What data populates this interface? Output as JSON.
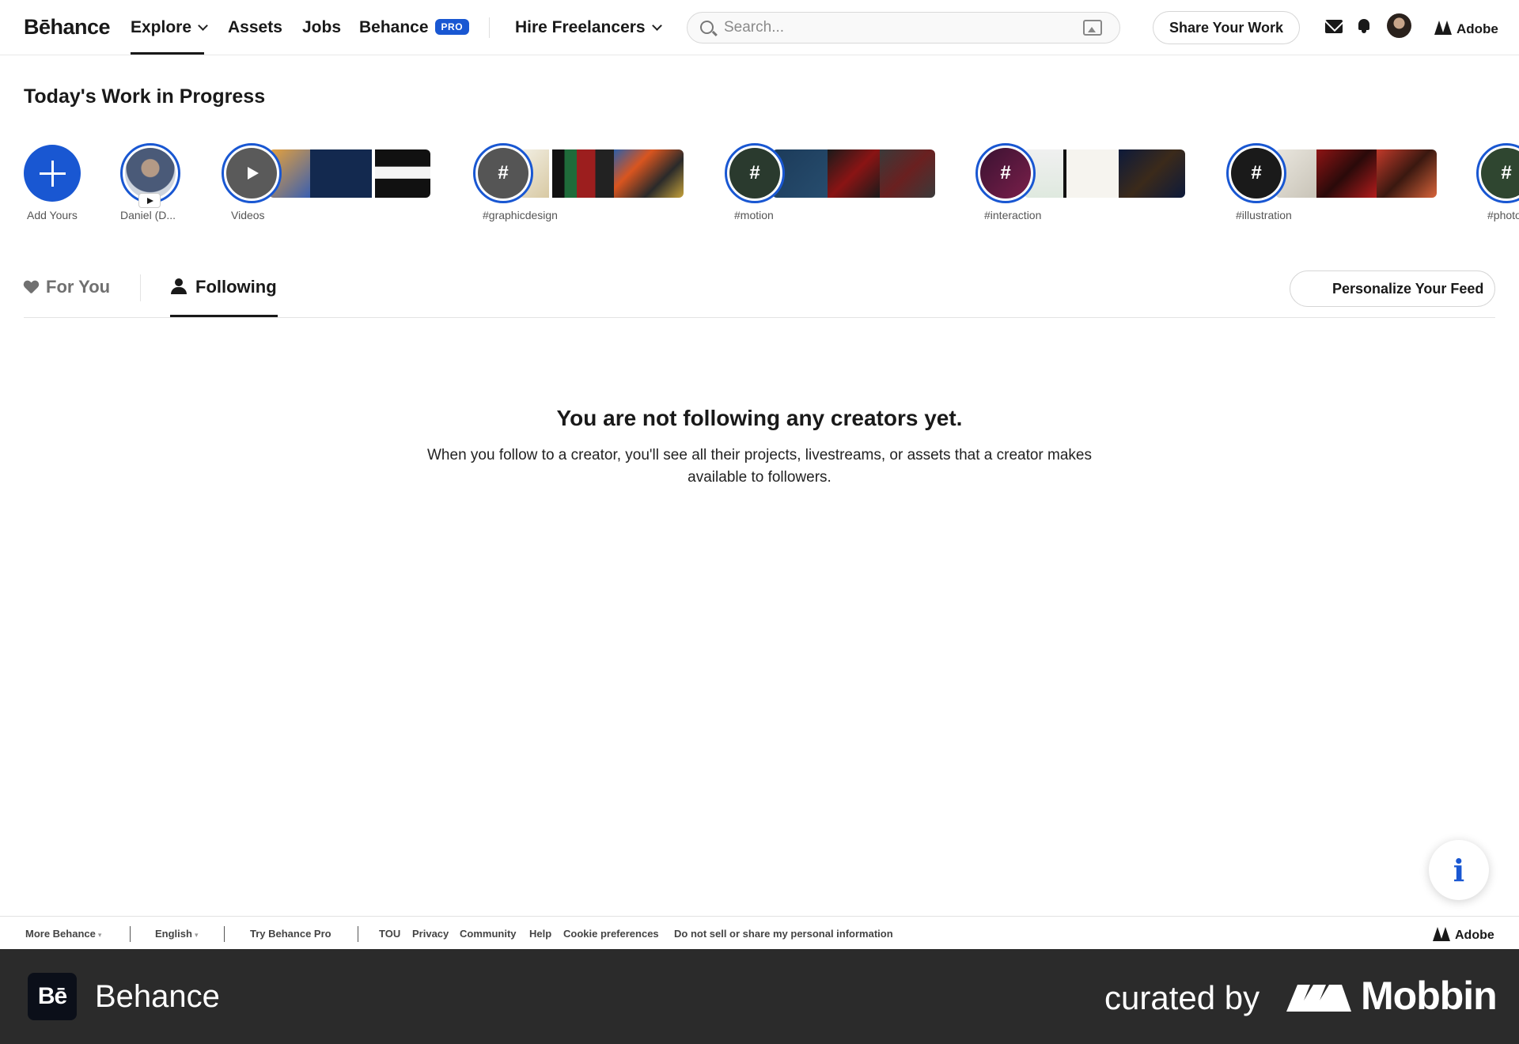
{
  "nav": {
    "logo": "Bēhance",
    "explore": "Explore",
    "assets": "Assets",
    "jobs": "Jobs",
    "behance": "Behance",
    "pro_badge": "PRO",
    "hire": "Hire Freelancers",
    "search_placeholder": "Search...",
    "share": "Share Your Work",
    "adobe": "Adobe",
    "accent_color": "#1957d2"
  },
  "wip": {
    "title": "Today's Work in Progress",
    "stories": [
      {
        "label": "Add Yours",
        "kind": "add"
      },
      {
        "label": "Daniel (D...",
        "kind": "avatar"
      },
      {
        "label": "Videos",
        "kind": "play"
      },
      {
        "label": "#graphicdesign",
        "kind": "hashtag"
      },
      {
        "label": "#motion",
        "kind": "hashtag"
      },
      {
        "label": "#interaction",
        "kind": "hashtag"
      },
      {
        "label": "#illustration",
        "kind": "hashtag"
      },
      {
        "label": "#photo",
        "kind": "hashtag"
      }
    ],
    "hash_symbol": "#"
  },
  "tabs": {
    "for_you": "For You",
    "following": "Following",
    "active": "Following",
    "personalize": "Personalize Your Feed"
  },
  "empty": {
    "title": "You are not following any creators yet.",
    "text": "When you follow to a creator, you'll see all their projects, livestreams, or assets that a creator makes available to followers."
  },
  "info_fab": "i",
  "footer": {
    "more": "More Behance",
    "language": "English",
    "try_pro": "Try Behance Pro",
    "links": [
      "TOU",
      "Privacy",
      "Community",
      "Help",
      "Cookie preferences",
      "Do not sell or share my personal information"
    ],
    "adobe": "Adobe"
  },
  "watermark": {
    "app_icon": "Bē",
    "app_name": "Behance",
    "curated": "curated by",
    "brand": "Mobbin"
  }
}
